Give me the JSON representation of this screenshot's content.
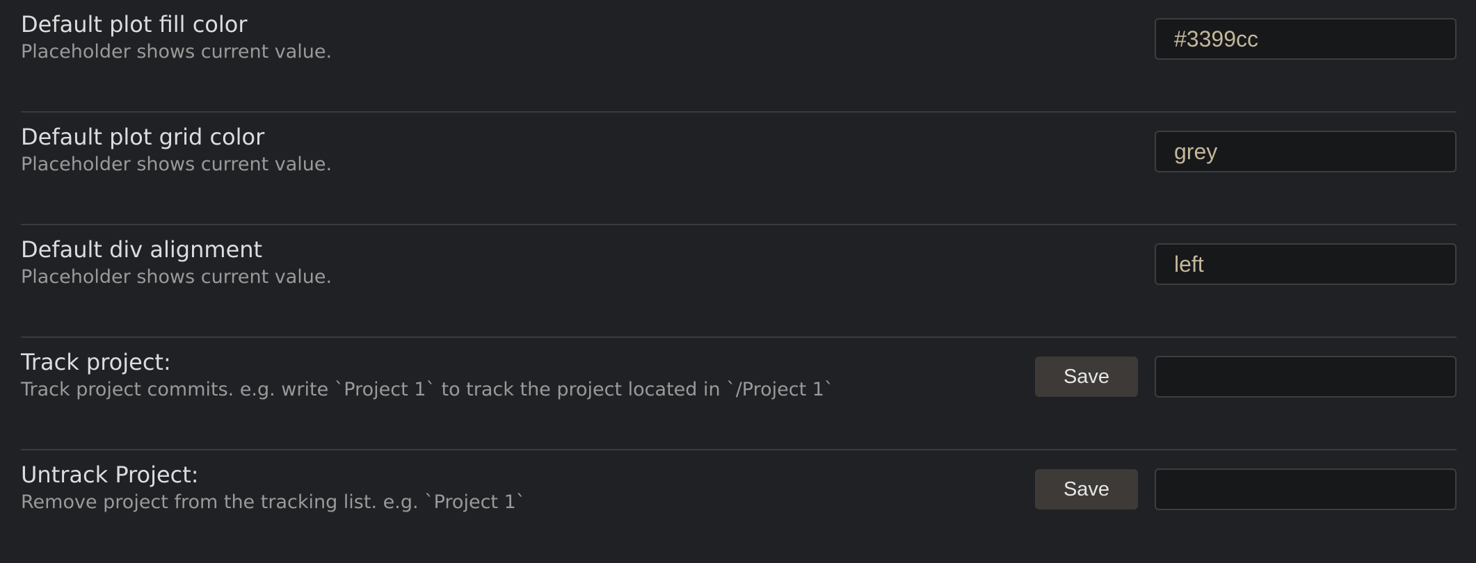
{
  "settings": [
    {
      "name": "Default plot fill color",
      "description": "Placeholder shows current value.",
      "placeholder": "#3399cc"
    },
    {
      "name": "Default plot grid color",
      "description": "Placeholder shows current value.",
      "placeholder": "grey"
    },
    {
      "name": "Default div alignment",
      "description": "Placeholder shows current value.",
      "placeholder": "left"
    },
    {
      "name": "Track project:",
      "description": "Track project commits. e.g. write `Project 1` to track the project located in `/Project 1`",
      "button_label": "Save",
      "placeholder": ""
    },
    {
      "name": "Untrack Project:",
      "description": "Remove project from the tracking list. e.g. `Project 1`",
      "button_label": "Save",
      "placeholder": ""
    }
  ],
  "colors": {
    "background": "#202124",
    "input_background": "#17181a",
    "button_background": "#3d3a38",
    "placeholder_text": "#c4b79a",
    "description_text": "#9a9a9a"
  }
}
